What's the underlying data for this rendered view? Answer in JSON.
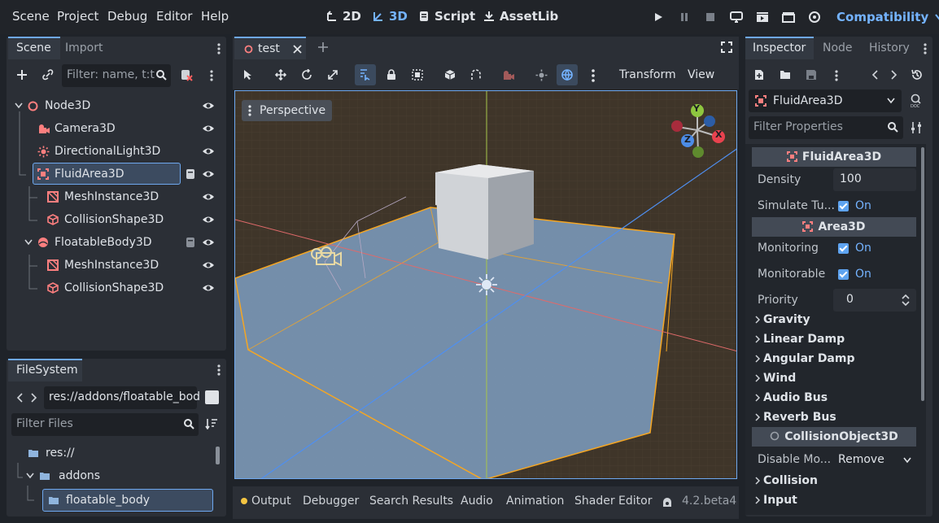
{
  "menu": [
    "Scene",
    "Project",
    "Debug",
    "Editor",
    "Help"
  ],
  "workspaces": [
    {
      "label": "2D",
      "active": false
    },
    {
      "label": "3D",
      "active": true
    },
    {
      "label": "Script",
      "active": false
    },
    {
      "label": "AssetLib",
      "active": false
    }
  ],
  "renderer": "Compatibility",
  "scene_dock": {
    "tabs": [
      "Scene",
      "Import"
    ],
    "filter_placeholder": "Filter: name, t:t",
    "tree": [
      {
        "label": "Node3D",
        "icon": "node3d-icon",
        "depth": 0,
        "expanded": true
      },
      {
        "label": "Camera3D",
        "icon": "camera-icon",
        "depth": 1
      },
      {
        "label": "DirectionalLight3D",
        "icon": "light-icon",
        "depth": 1
      },
      {
        "label": "FluidArea3D",
        "icon": "area-icon",
        "depth": 1,
        "selected": true,
        "expanded": true,
        "script": true
      },
      {
        "label": "MeshInstance3D",
        "icon": "mesh-icon",
        "depth": 2
      },
      {
        "label": "CollisionShape3D",
        "icon": "collision-icon",
        "depth": 2
      },
      {
        "label": "FloatableBody3D",
        "icon": "body-icon",
        "depth": 1,
        "expanded": true,
        "script": true
      },
      {
        "label": "MeshInstance3D",
        "icon": "mesh-icon",
        "depth": 2
      },
      {
        "label": "CollisionShape3D",
        "icon": "collision-icon",
        "depth": 2
      }
    ]
  },
  "filesystem": {
    "title": "FileSystem",
    "path": "res://addons/floatable_bod",
    "filter_placeholder": "Filter Files",
    "items": [
      {
        "label": "res://",
        "depth": 0
      },
      {
        "label": "addons",
        "depth": 1
      },
      {
        "label": "floatable_body",
        "depth": 2,
        "selected": true
      }
    ]
  },
  "viewport": {
    "tab": "test",
    "menus": [
      "Transform",
      "View"
    ],
    "view_label": "Perspective",
    "gizmo_axes": {
      "x": "X",
      "y": "Y",
      "z": "Z"
    }
  },
  "bottom_panel": {
    "tabs": [
      "Output",
      "Debugger",
      "Search Results",
      "Audio",
      "Animation",
      "Shader Editor"
    ],
    "version": "4.2.beta4"
  },
  "inspector": {
    "tabs": [
      "Inspector",
      "Node",
      "History"
    ],
    "node_name": "FluidArea3D",
    "filter_placeholder": "Filter Properties",
    "section_fluid": "FluidArea3D",
    "density_label": "Density",
    "density_value": "100",
    "simulate_label": "Simulate Tu...",
    "simulate_value": "On",
    "section_area": "Area3D",
    "monitoring_label": "Monitoring",
    "monitoring_value": "On",
    "monitorable_label": "Monitorable",
    "monitorable_value": "On",
    "priority_label": "Priority",
    "priority_value": "0",
    "groups": [
      "Gravity",
      "Linear Damp",
      "Angular Damp",
      "Wind",
      "Audio Bus",
      "Reverb Bus"
    ],
    "section_collision": "CollisionObject3D",
    "disable_label": "Disable Mo...",
    "disable_value": "Remove",
    "groups2": [
      "Collision",
      "Input"
    ]
  },
  "colors": {
    "accent": "#6ea8ef",
    "selection_orange": "#f5a623",
    "bg": "#1f2329"
  }
}
